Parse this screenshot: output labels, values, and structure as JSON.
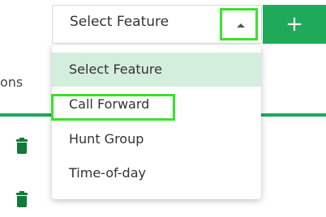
{
  "table": {
    "column_header_partial": "ons"
  },
  "feature_select": {
    "value": "Select Feature",
    "add_button_label": "+",
    "options": [
      {
        "label": "Select Feature",
        "selected": true
      },
      {
        "label": "Call Forward",
        "selected": false,
        "focused": true
      },
      {
        "label": "Hunt Group",
        "selected": false
      },
      {
        "label": "Time-of-day",
        "selected": false
      }
    ]
  },
  "colors": {
    "accent_green": "#1faa5a",
    "highlight_green": "#39e22b",
    "selected_bg": "#d4eedd"
  },
  "icons": [
    "trash-icon",
    "caret-up-icon",
    "plus-icon"
  ]
}
